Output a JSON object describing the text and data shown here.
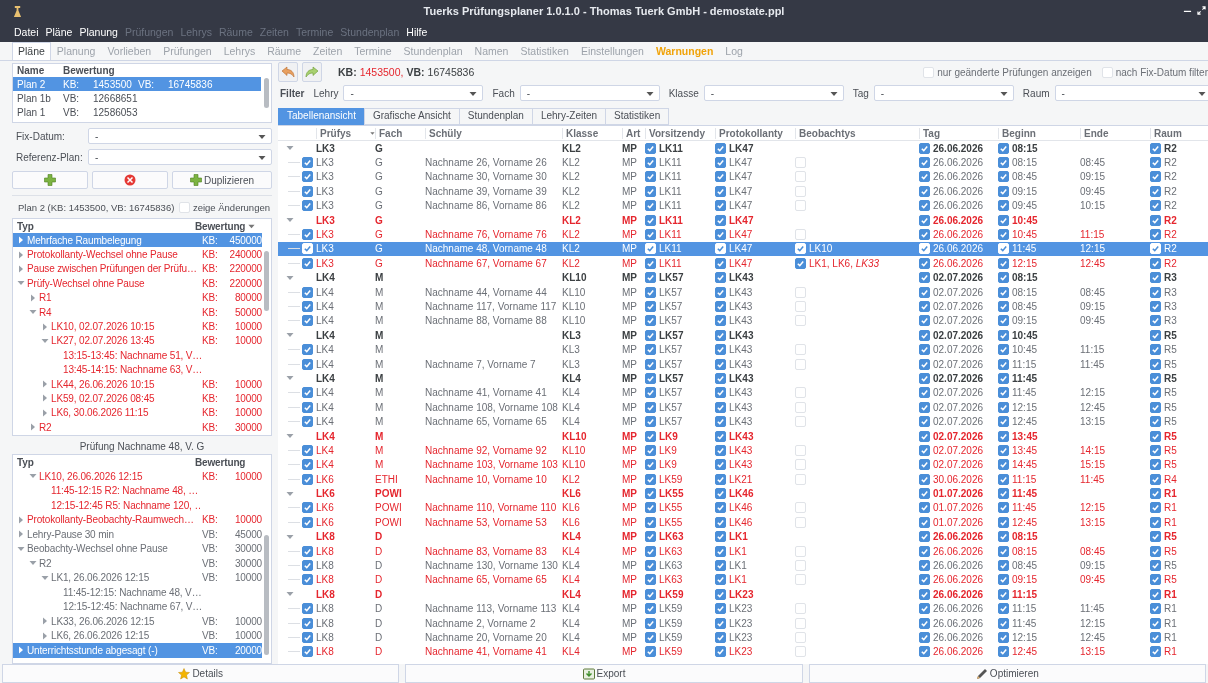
{
  "window": {
    "title": "Tuerks Prüfungsplaner 1.0.1.0 - Thomas Tuerk GmbH - demostate.ppl"
  },
  "menu": [
    {
      "label": "Datei",
      "disabled": false
    },
    {
      "label": "Pläne",
      "disabled": false
    },
    {
      "label": "Planung",
      "disabled": false
    },
    {
      "label": "Prüfungen",
      "disabled": true
    },
    {
      "label": "Lehrys",
      "disabled": true
    },
    {
      "label": "Räume",
      "disabled": true
    },
    {
      "label": "Zeiten",
      "disabled": true
    },
    {
      "label": "Termine",
      "disabled": true
    },
    {
      "label": "Stundenplan",
      "disabled": true
    },
    {
      "label": "Hilfe",
      "disabled": false
    }
  ],
  "tabs": [
    {
      "label": "Pläne",
      "selected": true,
      "highlight": false
    },
    {
      "label": "Planung",
      "selected": false,
      "highlight": false
    },
    {
      "label": "Vorlieben",
      "selected": false,
      "highlight": false
    },
    {
      "label": "Prüfungen",
      "selected": false,
      "highlight": false
    },
    {
      "label": "Lehrys",
      "selected": false,
      "highlight": false
    },
    {
      "label": "Räume",
      "selected": false,
      "highlight": false
    },
    {
      "label": "Zeiten",
      "selected": false,
      "highlight": false
    },
    {
      "label": "Termine",
      "selected": false,
      "highlight": false
    },
    {
      "label": "Stundenplan",
      "selected": false,
      "highlight": false
    },
    {
      "label": "Namen",
      "selected": false,
      "highlight": false
    },
    {
      "label": "Statistiken",
      "selected": false,
      "highlight": false
    },
    {
      "label": "Einstellungen",
      "selected": false,
      "highlight": false
    },
    {
      "label": "Warnungen",
      "selected": false,
      "highlight": true
    },
    {
      "label": "Log",
      "selected": false,
      "highlight": false
    }
  ],
  "plans": {
    "columns": [
      "Name",
      "Bewertung"
    ],
    "rows": [
      {
        "name": "Plan 2",
        "selected": true,
        "parts": [
          {
            "kind": "label",
            "text": "KB:"
          },
          {
            "kind": "value",
            "text": "1453500"
          },
          {
            "kind": "label",
            "text": "VB:"
          },
          {
            "kind": "value",
            "text": "16745836"
          }
        ]
      },
      {
        "name": "Plan 1b",
        "selected": false,
        "parts": [
          {
            "kind": "label",
            "text": "VB:"
          },
          {
            "kind": "value",
            "text": "12668651"
          }
        ]
      },
      {
        "name": "Plan 1",
        "selected": false,
        "parts": [
          {
            "kind": "label",
            "text": "VB:"
          },
          {
            "kind": "value",
            "text": "12586053"
          }
        ]
      }
    ]
  },
  "fix_date": {
    "label": "Fix-Datum:",
    "value": "-"
  },
  "reference_plan": {
    "label": "Referenz-Plan:",
    "value": "-"
  },
  "plan_buttons": [
    {
      "kind": "add"
    },
    {
      "kind": "delete"
    },
    {
      "kind": "add",
      "label": "Duplizieren"
    }
  ],
  "plan_summary": "Plan 2 (KB: 1453500, VB: 16745836)",
  "show_changes": {
    "label": "zeige Änderungen",
    "checked": false
  },
  "warnings": {
    "columns": [
      "Typ",
      "Bewertung"
    ],
    "items": [
      {
        "label": "Mehrfache Raumbelegung",
        "score_label": "KB:",
        "score": "450000",
        "severe": true,
        "expanded": false,
        "selected": true
      },
      {
        "label": "Protokollanty-Wechsel ohne Pause",
        "score_label": "KB:",
        "score": "240000",
        "severe": true,
        "expanded": false,
        "selected": false
      },
      {
        "label": "Pause zwischen Prüfungen der Prüfu…",
        "score_label": "KB:",
        "score": "220000",
        "severe": true,
        "expanded": false,
        "selected": false
      },
      {
        "label": "Prüfy-Wechsel ohne Pause",
        "score_label": "KB:",
        "score": "220000",
        "severe": true,
        "expanded": true,
        "selected": false,
        "children": [
          {
            "label": "R1",
            "score_label": "KB:",
            "score": "80000",
            "severe": true,
            "expanded": false,
            "selected": false
          },
          {
            "label": "R4",
            "score_label": "KB:",
            "score": "50000",
            "severe": true,
            "expanded": true,
            "selected": false,
            "children": [
              {
                "label": "LK10, 02.07.2026 10:15",
                "score_label": "KB:",
                "score": "10000",
                "severe": true,
                "expanded": false,
                "selected": false
              },
              {
                "label": "LK27, 02.07.2026 13:45",
                "score_label": "KB:",
                "score": "10000",
                "severe": true,
                "expanded": true,
                "selected": false,
                "children": [
                  {
                    "label": "13:15-13:45: Nachname 51, V…",
                    "severe": true,
                    "selected": false
                  },
                  {
                    "label": "13:45-14:15: Nachname 63, V…",
                    "severe": true,
                    "selected": false
                  }
                ]
              },
              {
                "label": "LK44, 26.06.2026 10:15",
                "score_label": "KB:",
                "score": "10000",
                "severe": true,
                "expanded": false,
                "selected": false
              },
              {
                "label": "LK59, 02.07.2026 08:45",
                "score_label": "KB:",
                "score": "10000",
                "severe": true,
                "expanded": false,
                "selected": false
              },
              {
                "label": "LK6, 30.06.2026 11:15",
                "score_label": "KB:",
                "score": "10000",
                "severe": true,
                "expanded": false,
                "selected": false
              }
            ]
          },
          {
            "label": "R2",
            "score_label": "KB:",
            "score": "30000",
            "severe": true,
            "expanded": false,
            "selected": false
          }
        ]
      }
    ]
  },
  "exam_warnings": {
    "title": "Prüfung Nachname 48, V. G",
    "columns": [
      "Typ",
      "Bewertung"
    ],
    "items": [
      {
        "children": [
          {
            "label": "LK10, 26.06.2026 12:15",
            "score_label": "KB:",
            "score": "10000",
            "severe": true,
            "expanded": true,
            "selected": false,
            "children": [
              {
                "label": "11:45-12:15 R2: Nachname 48, …",
                "severe": true,
                "selected": false
              },
              {
                "label": "12:15-12:45 R5: Nachname 120, …",
                "severe": true,
                "selected": false
              }
            ]
          }
        ]
      },
      {
        "label": "Protokollanty-Beobachty-Raumwech…",
        "score_label": "KB:",
        "score": "10000",
        "severe": true,
        "expanded": false,
        "selected": false
      },
      {
        "label": "Lehry-Pause 30 min",
        "score_label": "VB:",
        "score": "45000",
        "severe": false,
        "expanded": false,
        "selected": false
      },
      {
        "label": "Beobachty-Wechsel ohne Pause",
        "score_label": "VB:",
        "score": "30000",
        "severe": false,
        "expanded": true,
        "selected": false,
        "children": [
          {
            "label": "R2",
            "score_label": "VB:",
            "score": "30000",
            "severe": false,
            "expanded": true,
            "selected": false,
            "children": [
              {
                "label": "LK1, 26.06.2026 12:15",
                "score_label": "VB:",
                "score": "10000",
                "severe": false,
                "expanded": true,
                "selected": false,
                "children": [
                  {
                    "label": "11:45-12:15: Nachname 48, V…",
                    "severe": false,
                    "selected": false
                  },
                  {
                    "label": "12:15-12:45: Nachname 67, V…",
                    "severe": false,
                    "selected": false
                  }
                ]
              },
              {
                "label": "LK33, 26.06.2026 12:15",
                "score_label": "VB:",
                "score": "10000",
                "severe": false,
                "expanded": false,
                "selected": false
              },
              {
                "label": "LK6, 26.06.2026 12:15",
                "score_label": "VB:",
                "score": "10000",
                "severe": false,
                "expanded": false,
                "selected": false
              }
            ]
          }
        ]
      },
      {
        "label": "Unterrichtsstunde abgesagt (-)",
        "score_label": "VB:",
        "score": "20000",
        "severe": false,
        "expanded": false,
        "selected": true
      }
    ]
  },
  "toolbar": {
    "summary": [
      {
        "kind": "label",
        "text": "KB:"
      },
      {
        "kind": "bad",
        "text": "1453500,"
      },
      {
        "kind": "label",
        "text": "VB:"
      },
      {
        "kind": "value",
        "text": "16745836"
      }
    ],
    "options": [
      {
        "label": "nur geänderte Prüfungen anzeigen",
        "checked": false
      },
      {
        "label": "nach Fix-Datum filter",
        "checked": false
      }
    ]
  },
  "filter": {
    "label": "Filter",
    "fields": [
      {
        "label": "Lehry",
        "value": "-"
      },
      {
        "label": "Fach",
        "value": "-"
      },
      {
        "label": "Klasse",
        "value": "-"
      },
      {
        "label": "Tag",
        "value": "-"
      },
      {
        "label": "Raum",
        "value": "-"
      }
    ]
  },
  "view_tabs": [
    {
      "label": "Tabellenansicht",
      "selected": true
    },
    {
      "label": "Grafische Ansicht",
      "selected": false
    },
    {
      "label": "Stundenplan",
      "selected": false
    },
    {
      "label": "Lehry-Zeiten",
      "selected": false
    },
    {
      "label": "Statistiken",
      "selected": false
    }
  ],
  "table": {
    "columns": [
      "Prüfys",
      "Fach",
      "Schüly",
      "Klasse",
      "Art",
      "Vorsitzendy",
      "Protokollanty",
      "Beobachtys",
      "Tag",
      "Beginn",
      "Ende",
      "Raum"
    ],
    "rows": [
      {
        "kind": "group",
        "expanded": true,
        "selected": false,
        "warning": false,
        "fixed": true,
        "pruefys": "LK3",
        "fach": "G",
        "klasse": "KL2",
        "art": "MP",
        "vorsitzendy": "LK11",
        "protokollanty": "LK47",
        "tag": "26.06.2026",
        "beginn": "08:15",
        "raum": "R2",
        "children": [
          {
            "kind": "exam",
            "checked": true,
            "selected": false,
            "warning": false,
            "fixed": true,
            "pruefys": "LK3",
            "fach": "G",
            "schuely": "Nachname 26, Vorname 26",
            "klasse": "KL2",
            "art": "MP",
            "vorsitzendy": "LK11",
            "protokollanty": "LK47",
            "beob_checked": false,
            "tag": "26.06.2026",
            "beginn": "08:15",
            "ende": "08:45",
            "raum": "R2"
          },
          {
            "kind": "exam",
            "checked": true,
            "selected": false,
            "warning": false,
            "fixed": true,
            "pruefys": "LK3",
            "fach": "G",
            "schuely": "Nachname 30, Vorname 30",
            "klasse": "KL2",
            "art": "MP",
            "vorsitzendy": "LK11",
            "protokollanty": "LK47",
            "beob_checked": false,
            "tag": "26.06.2026",
            "beginn": "08:45",
            "ende": "09:15",
            "raum": "R2"
          },
          {
            "kind": "exam",
            "checked": true,
            "selected": false,
            "warning": false,
            "fixed": true,
            "pruefys": "LK3",
            "fach": "G",
            "schuely": "Nachname 39, Vorname 39",
            "klasse": "KL2",
            "art": "MP",
            "vorsitzendy": "LK11",
            "protokollanty": "LK47",
            "beob_checked": false,
            "tag": "26.06.2026",
            "beginn": "09:15",
            "ende": "09:45",
            "raum": "R2"
          },
          {
            "kind": "exam",
            "checked": true,
            "selected": false,
            "warning": false,
            "fixed": true,
            "pruefys": "LK3",
            "fach": "G",
            "schuely": "Nachname 86, Vorname 86",
            "klasse": "KL2",
            "art": "MP",
            "vorsitzendy": "LK11",
            "protokollanty": "LK47",
            "beob_checked": false,
            "tag": "26.06.2026",
            "beginn": "09:45",
            "ende": "10:15",
            "raum": "R2"
          }
        ]
      },
      {
        "kind": "group",
        "expanded": true,
        "selected": false,
        "warning": true,
        "fixed": true,
        "pruefys": "LK3",
        "fach": "G",
        "klasse": "KL2",
        "art": "MP",
        "vorsitzendy": "LK11",
        "protokollanty": "LK47",
        "tag": "26.06.2026",
        "beginn": "10:45",
        "raum": "R2",
        "children": [
          {
            "kind": "exam",
            "checked": true,
            "selected": false,
            "warning": true,
            "fixed": true,
            "pruefys": "LK3",
            "fach": "G",
            "schuely": "Nachname 76, Vorname 76",
            "klasse": "KL2",
            "art": "MP",
            "vorsitzendy": "LK11",
            "protokollanty": "LK47",
            "beob_checked": false,
            "tag": "26.06.2026",
            "beginn": "10:45",
            "ende": "11:15",
            "raum": "R2"
          },
          {
            "kind": "exam",
            "checked": true,
            "selected": true,
            "warning": false,
            "fixed": true,
            "pruefys": "LK3",
            "fach": "G",
            "schuely": "Nachname 48, Vorname 48",
            "klasse": "KL2",
            "art": "MP",
            "vorsitzendy": "LK11",
            "protokollanty": "LK47",
            "beob_checked": true,
            "beobachtys": "LK10",
            "tag": "26.06.2026",
            "beginn": "11:45",
            "ende": "12:15",
            "raum": "R2"
          },
          {
            "kind": "exam",
            "checked": true,
            "selected": false,
            "warning": true,
            "fixed": true,
            "pruefys": "LK3",
            "fach": "G",
            "schuely": "Nachname 67, Vorname 67",
            "klasse": "KL2",
            "art": "MP",
            "vorsitzendy": "LK11",
            "protokollanty": "LK47",
            "beob_checked": true,
            "beobachtys": "LK1, LK6, *LK33*",
            "tag": "26.06.2026",
            "beginn": "12:15",
            "ende": "12:45",
            "raum": "R2"
          }
        ]
      },
      {
        "kind": "group",
        "expanded": true,
        "selected": false,
        "warning": false,
        "fixed": true,
        "pruefys": "LK4",
        "fach": "M",
        "klasse": "KL10",
        "art": "MP",
        "vorsitzendy": "LK57",
        "protokollanty": "LK43",
        "tag": "02.07.2026",
        "beginn": "08:15",
        "raum": "R3",
        "children": [
          {
            "kind": "exam",
            "checked": true,
            "selected": false,
            "warning": false,
            "fixed": true,
            "pruefys": "LK4",
            "fach": "M",
            "schuely": "Nachname 44, Vorname 44",
            "klasse": "KL10",
            "art": "MP",
            "vorsitzendy": "LK57",
            "protokollanty": "LK43",
            "beob_checked": false,
            "tag": "02.07.2026",
            "beginn": "08:15",
            "ende": "08:45",
            "raum": "R3"
          },
          {
            "kind": "exam",
            "checked": true,
            "selected": false,
            "warning": false,
            "fixed": true,
            "pruefys": "LK4",
            "fach": "M",
            "schuely": "Nachname 117, Vorname 117",
            "klasse": "KL10",
            "art": "MP",
            "vorsitzendy": "LK57",
            "protokollanty": "LK43",
            "beob_checked": false,
            "tag": "02.07.2026",
            "beginn": "08:45",
            "ende": "09:15",
            "raum": "R3"
          },
          {
            "kind": "exam",
            "checked": true,
            "selected": false,
            "warning": false,
            "fixed": true,
            "pruefys": "LK4",
            "fach": "M",
            "schuely": "Nachname 88, Vorname 88",
            "klasse": "KL10",
            "art": "MP",
            "vorsitzendy": "LK57",
            "protokollanty": "LK43",
            "beob_checked": false,
            "tag": "02.07.2026",
            "beginn": "09:15",
            "ende": "09:45",
            "raum": "R3"
          }
        ]
      },
      {
        "kind": "group",
        "expanded": true,
        "selected": false,
        "warning": false,
        "fixed": true,
        "pruefys": "LK4",
        "fach": "M",
        "klasse": "KL3",
        "art": "MP",
        "vorsitzendy": "LK57",
        "protokollanty": "LK43",
        "tag": "02.07.2026",
        "beginn": "10:45",
        "raum": "R5",
        "children": [
          {
            "kind": "exam",
            "checked": true,
            "selected": false,
            "warning": false,
            "fixed": true,
            "pruefys": "LK4",
            "fach": "M",
            "klasse": "KL3",
            "art": "MP",
            "vorsitzendy": "LK57",
            "protokollanty": "LK43",
            "beob_checked": false,
            "tag": "02.07.2026",
            "beginn": "10:45",
            "ende": "11:15",
            "raum": "R5"
          },
          {
            "kind": "exam",
            "checked": true,
            "selected": false,
            "warning": false,
            "fixed": true,
            "pruefys": "LK4",
            "fach": "M",
            "schuely": "Nachname 7, Vorname 7",
            "klasse": "KL3",
            "art": "MP",
            "vorsitzendy": "LK57",
            "protokollanty": "LK43",
            "beob_checked": false,
            "tag": "02.07.2026",
            "beginn": "11:15",
            "ende": "11:45",
            "raum": "R5"
          }
        ]
      },
      {
        "kind": "group",
        "expanded": true,
        "selected": false,
        "warning": false,
        "fixed": true,
        "pruefys": "LK4",
        "fach": "M",
        "klasse": "KL4",
        "art": "MP",
        "vorsitzendy": "LK57",
        "protokollanty": "LK43",
        "tag": "02.07.2026",
        "beginn": "11:45",
        "raum": "R5",
        "children": [
          {
            "kind": "exam",
            "checked": true,
            "selected": false,
            "warning": false,
            "fixed": true,
            "pruefys": "LK4",
            "fach": "M",
            "schuely": "Nachname 41, Vorname 41",
            "klasse": "KL4",
            "art": "MP",
            "vorsitzendy": "LK57",
            "protokollanty": "LK43",
            "beob_checked": false,
            "tag": "02.07.2026",
            "beginn": "11:45",
            "ende": "12:15",
            "raum": "R5"
          },
          {
            "kind": "exam",
            "checked": true,
            "selected": false,
            "warning": false,
            "fixed": true,
            "pruefys": "LK4",
            "fach": "M",
            "schuely": "Nachname 108, Vorname 108",
            "klasse": "KL4",
            "art": "MP",
            "vorsitzendy": "LK57",
            "protokollanty": "LK43",
            "beob_checked": false,
            "tag": "02.07.2026",
            "beginn": "12:15",
            "ende": "12:45",
            "raum": "R5"
          },
          {
            "kind": "exam",
            "checked": true,
            "selected": false,
            "warning": false,
            "fixed": true,
            "pruefys": "LK4",
            "fach": "M",
            "schuely": "Nachname 65, Vorname 65",
            "klasse": "KL4",
            "art": "MP",
            "vorsitzendy": "LK57",
            "protokollanty": "LK43",
            "beob_checked": false,
            "tag": "02.07.2026",
            "beginn": "12:45",
            "ende": "13:15",
            "raum": "R5"
          }
        ]
      },
      {
        "kind": "group",
        "expanded": true,
        "selected": false,
        "warning": true,
        "fixed": true,
        "pruefys": "LK4",
        "fach": "M",
        "klasse": "KL10",
        "art": "MP",
        "vorsitzendy": "LK9",
        "protokollanty": "LK43",
        "tag": "02.07.2026",
        "beginn": "13:45",
        "raum": "R5",
        "children": [
          {
            "kind": "exam",
            "checked": true,
            "selected": false,
            "warning": true,
            "fixed": true,
            "pruefys": "LK4",
            "fach": "M",
            "schuely": "Nachname 92, Vorname 92",
            "klasse": "KL10",
            "art": "MP",
            "vorsitzendy": "LK9",
            "protokollanty": "LK43",
            "beob_checked": false,
            "tag": "02.07.2026",
            "beginn": "13:45",
            "ende": "14:15",
            "raum": "R5"
          },
          {
            "kind": "exam",
            "checked": true,
            "selected": false,
            "warning": true,
            "fixed": true,
            "pruefys": "LK4",
            "fach": "M",
            "schuely": "Nachname 103, Vorname 103",
            "klasse": "KL10",
            "art": "MP",
            "vorsitzendy": "LK9",
            "protokollanty": "LK43",
            "beob_checked": false,
            "tag": "02.07.2026",
            "beginn": "14:45",
            "ende": "15:15",
            "raum": "R5"
          }
        ]
      },
      {
        "kind": "exam",
        "checked": true,
        "selected": false,
        "warning": true,
        "fixed": true,
        "pruefys": "LK6",
        "fach": "ETHI",
        "schuely": "Nachname 10, Vorname 10",
        "klasse": "KL2",
        "art": "MP",
        "vorsitzendy": "LK59",
        "protokollanty": "LK21",
        "beob_checked": false,
        "tag": "30.06.2026",
        "beginn": "11:15",
        "ende": "11:45",
        "raum": "R4"
      },
      {
        "kind": "group",
        "expanded": true,
        "selected": false,
        "warning": true,
        "fixed": true,
        "pruefys": "LK6",
        "fach": "POWI",
        "klasse": "KL6",
        "art": "MP",
        "vorsitzendy": "LK55",
        "protokollanty": "LK46",
        "tag": "01.07.2026",
        "beginn": "11:45",
        "raum": "R1",
        "children": [
          {
            "kind": "exam",
            "checked": true,
            "selected": false,
            "warning": true,
            "fixed": true,
            "pruefys": "LK6",
            "fach": "POWI",
            "schuely": "Nachname 110, Vorname 110",
            "klasse": "KL6",
            "art": "MP",
            "vorsitzendy": "LK55",
            "protokollanty": "LK46",
            "beob_checked": false,
            "tag": "01.07.2026",
            "beginn": "11:45",
            "ende": "12:15",
            "raum": "R1"
          },
          {
            "kind": "exam",
            "checked": true,
            "selected": false,
            "warning": true,
            "fixed": true,
            "pruefys": "LK6",
            "fach": "POWI",
            "schuely": "Nachname 53, Vorname 53",
            "klasse": "KL6",
            "art": "MP",
            "vorsitzendy": "LK55",
            "protokollanty": "LK46",
            "beob_checked": false,
            "tag": "01.07.2026",
            "beginn": "12:45",
            "ende": "13:15",
            "raum": "R1"
          }
        ]
      },
      {
        "kind": "group",
        "expanded": true,
        "selected": false,
        "warning": true,
        "fixed": true,
        "pruefys": "LK8",
        "fach": "D",
        "klasse": "KL4",
        "art": "MP",
        "vorsitzendy": "LK63",
        "protokollanty": "LK1",
        "tag": "26.06.2026",
        "beginn": "08:15",
        "raum": "R5",
        "children": [
          {
            "kind": "exam",
            "checked": true,
            "selected": false,
            "warning": true,
            "fixed": true,
            "pruefys": "LK8",
            "fach": "D",
            "schuely": "Nachname 83, Vorname 83",
            "klasse": "KL4",
            "art": "MP",
            "vorsitzendy": "LK63",
            "protokollanty": "LK1",
            "beob_checked": false,
            "tag": "26.06.2026",
            "beginn": "08:15",
            "ende": "08:45",
            "raum": "R5"
          },
          {
            "kind": "exam",
            "checked": true,
            "selected": false,
            "warning": false,
            "fixed": true,
            "pruefys": "LK8",
            "fach": "D",
            "schuely": "Nachname 130, Vorname 130",
            "klasse": "KL4",
            "art": "MP",
            "vorsitzendy": "LK63",
            "protokollanty": "LK1",
            "beob_checked": false,
            "tag": "26.06.2026",
            "beginn": "08:45",
            "ende": "09:15",
            "raum": "R5"
          },
          {
            "kind": "exam",
            "checked": true,
            "selected": false,
            "warning": true,
            "fixed": true,
            "pruefys": "LK8",
            "fach": "D",
            "schuely": "Nachname 65, Vorname 65",
            "klasse": "KL4",
            "art": "MP",
            "vorsitzendy": "LK63",
            "protokollanty": "LK1",
            "beob_checked": false,
            "tag": "26.06.2026",
            "beginn": "09:15",
            "ende": "09:45",
            "raum": "R5"
          }
        ]
      },
      {
        "kind": "group",
        "expanded": true,
        "selected": false,
        "warning": true,
        "fixed": true,
        "pruefys": "LK8",
        "fach": "D",
        "klasse": "KL4",
        "art": "MP",
        "vorsitzendy": "LK59",
        "protokollanty": "LK23",
        "tag": "26.06.2026",
        "beginn": "11:15",
        "raum": "R1",
        "children": [
          {
            "kind": "exam",
            "checked": true,
            "selected": false,
            "warning": false,
            "fixed": true,
            "pruefys": "LK8",
            "fach": "D",
            "schuely": "Nachname 113, Vorname 113",
            "klasse": "KL4",
            "art": "MP",
            "vorsitzendy": "LK59",
            "protokollanty": "LK23",
            "beob_checked": false,
            "tag": "26.06.2026",
            "beginn": "11:15",
            "ende": "11:45",
            "raum": "R1"
          },
          {
            "kind": "exam",
            "checked": true,
            "selected": false,
            "warning": false,
            "fixed": true,
            "pruefys": "LK8",
            "fach": "D",
            "schuely": "Nachname 2, Vorname 2",
            "klasse": "KL4",
            "art": "MP",
            "vorsitzendy": "LK59",
            "protokollanty": "LK23",
            "beob_checked": false,
            "tag": "26.06.2026",
            "beginn": "11:45",
            "ende": "12:15",
            "raum": "R1"
          },
          {
            "kind": "exam",
            "checked": true,
            "selected": false,
            "warning": false,
            "fixed": true,
            "pruefys": "LK8",
            "fach": "D",
            "schuely": "Nachname 20, Vorname 20",
            "klasse": "KL4",
            "art": "MP",
            "vorsitzendy": "LK59",
            "protokollanty": "LK23",
            "beob_checked": false,
            "tag": "26.06.2026",
            "beginn": "12:15",
            "ende": "12:45",
            "raum": "R1"
          },
          {
            "kind": "exam",
            "checked": true,
            "selected": false,
            "warning": true,
            "fixed": true,
            "pruefys": "LK8",
            "fach": "D",
            "schuely": "Nachname 41, Vorname 41",
            "klasse": "KL4",
            "art": "MP",
            "vorsitzendy": "LK59",
            "protokollanty": "LK23",
            "beob_checked": false,
            "tag": "26.06.2026",
            "beginn": "12:45",
            "ende": "13:15",
            "raum": "R1"
          }
        ]
      }
    ]
  },
  "bottom_buttons": [
    {
      "kind": "star",
      "label": "Details"
    },
    {
      "kind": "export",
      "label": "Export"
    },
    {
      "kind": "pencil",
      "label": "Optimieren"
    }
  ]
}
